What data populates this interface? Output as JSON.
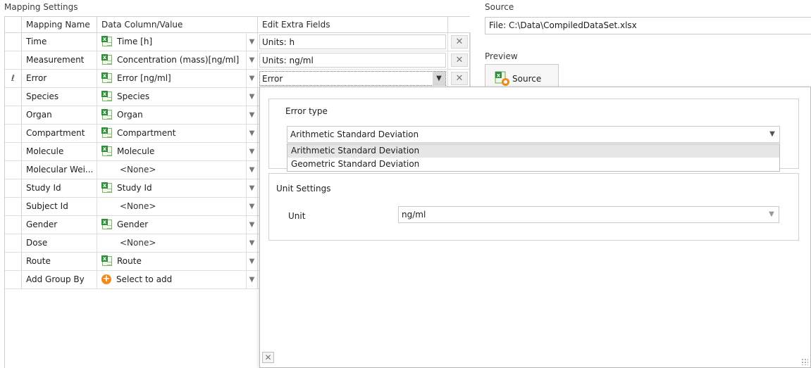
{
  "mapping_settings": {
    "title": "Mapping Settings",
    "columns": [
      "Mapping Name",
      "Data Column/Value",
      "Edit Extra Fields"
    ],
    "rows": [
      {
        "name": "Time",
        "value": "Time [h]",
        "icon": "excel-column-icon",
        "extra": "Units: h",
        "indicator": "",
        "deletable": true
      },
      {
        "name": "Measurement",
        "value": "Concentration (mass)[ng/ml]",
        "icon": "excel-column-icon",
        "extra": "Units: ng/ml",
        "indicator": "",
        "deletable": true
      },
      {
        "name": "Error",
        "value": "Error [ng/ml]",
        "icon": "excel-column-icon",
        "extra": "Error",
        "indicator": "ℓ",
        "deletable": true
      },
      {
        "name": "Species",
        "value": "Species",
        "icon": "excel-column-icon",
        "extra": "",
        "indicator": "",
        "deletable": false
      },
      {
        "name": "Organ",
        "value": "Organ",
        "icon": "excel-column-icon",
        "extra": "",
        "indicator": "",
        "deletable": false
      },
      {
        "name": "Compartment",
        "value": "Compartment",
        "icon": "excel-column-icon",
        "extra": "",
        "indicator": "",
        "deletable": false
      },
      {
        "name": "Molecule",
        "value": "Molecule",
        "icon": "excel-column-icon",
        "extra": "",
        "indicator": "",
        "deletable": false
      },
      {
        "name": "Molecular Wei...",
        "value": "<None>",
        "icon": "",
        "extra": "",
        "indicator": "",
        "deletable": false
      },
      {
        "name": "Study Id",
        "value": "Study Id",
        "icon": "excel-column-icon",
        "extra": "",
        "indicator": "",
        "deletable": false
      },
      {
        "name": "Subject Id",
        "value": "<None>",
        "icon": "",
        "extra": "",
        "indicator": "",
        "deletable": false
      },
      {
        "name": "Gender",
        "value": "Gender",
        "icon": "excel-column-icon",
        "extra": "",
        "indicator": "",
        "deletable": false
      },
      {
        "name": "Dose",
        "value": "<None>",
        "icon": "",
        "extra": "",
        "indicator": "",
        "deletable": false
      },
      {
        "name": "Route",
        "value": "Route",
        "icon": "excel-column-icon",
        "extra": "",
        "indicator": "",
        "deletable": false
      },
      {
        "name": "Add Group By",
        "value": "Select to add",
        "icon": "add-icon",
        "extra": "",
        "indicator": "",
        "deletable": false
      }
    ]
  },
  "source": {
    "title": "Source",
    "file_label": "File:",
    "file_path": "C:\\Data\\CompiledDataSet.xlsx",
    "preview_label": "Preview",
    "source_button_label": "Source"
  },
  "error_popup": {
    "error_type_label": "Error type",
    "error_type_selected": "Arithmetic Standard Deviation",
    "error_type_options": [
      "Arithmetic Standard Deviation",
      "Geometric Standard Deviation"
    ],
    "unit_settings_label": "Unit Settings",
    "unit_label": "Unit",
    "unit_value": "ng/ml"
  },
  "colors": {
    "excel_green": "#2f8f3b",
    "add_orange": "#f08a1c",
    "selected_item_bg": "#e6e6e6"
  }
}
